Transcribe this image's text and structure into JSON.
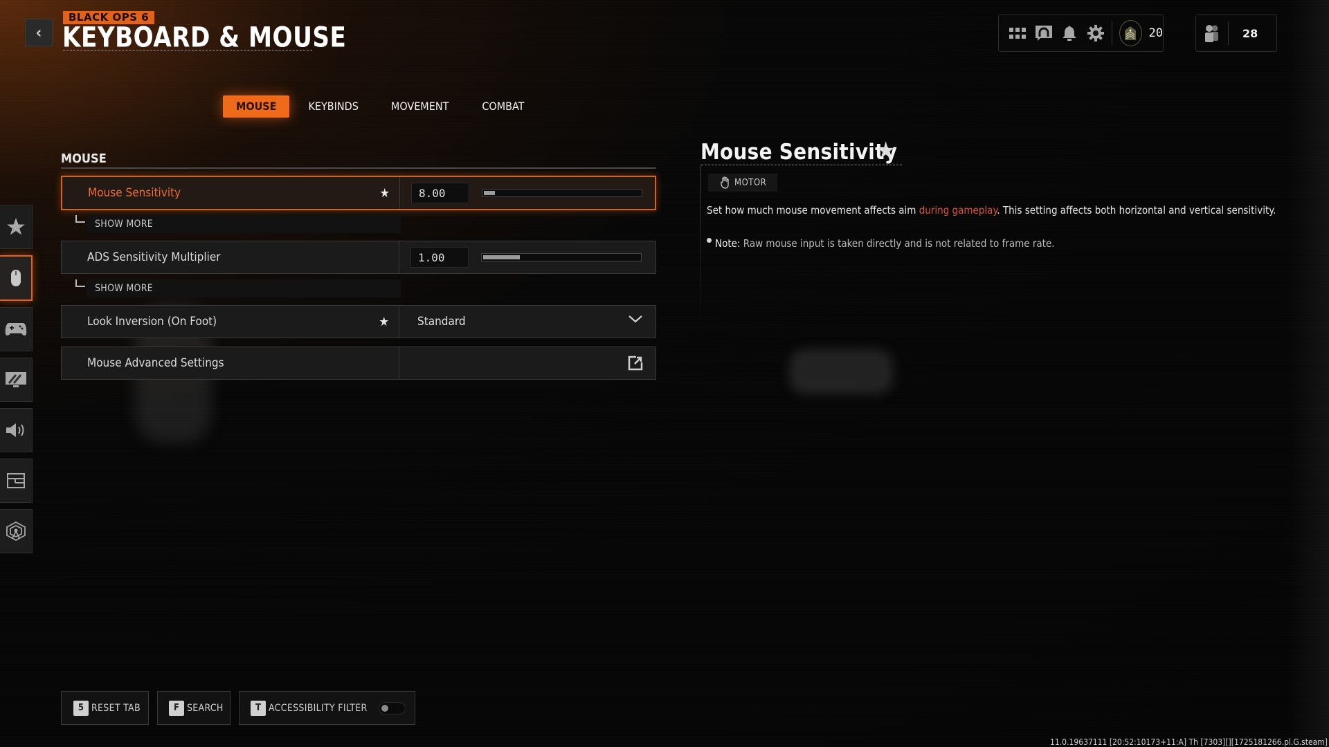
{
  "header": {
    "brand": "BLACK OPS 6",
    "title": "KEYBOARD & MOUSE",
    "back_icon": "chevron-left-icon"
  },
  "topbar": {
    "icons": [
      "grid-menu-icon",
      "headset-support-icon",
      "bell-icon",
      "gear-icon"
    ],
    "rank_icon": "rank-chevron-icon",
    "level": "20",
    "social_icon": "friends-icon",
    "friends_count": "28"
  },
  "tabs": [
    {
      "label": "MOUSE",
      "active": true
    },
    {
      "label": "KEYBINDS",
      "active": false
    },
    {
      "label": "MOVEMENT",
      "active": false
    },
    {
      "label": "COMBAT",
      "active": false
    }
  ],
  "sidebar": {
    "items": [
      {
        "icon": "star-icon",
        "active": false
      },
      {
        "icon": "mouse-icon",
        "active": true
      },
      {
        "icon": "gamepad-icon",
        "active": false
      },
      {
        "icon": "monitor-graphics-icon",
        "active": false
      },
      {
        "icon": "speaker-audio-icon",
        "active": false
      },
      {
        "icon": "interface-layout-icon",
        "active": false
      },
      {
        "icon": "network-icon",
        "active": false
      }
    ]
  },
  "section": {
    "label": "MOUSE",
    "settings": [
      {
        "label": "Mouse Sensitivity",
        "favorite": true,
        "type": "slider",
        "value": "8.00",
        "fill_fraction": 0.07,
        "show_more": "SHOW MORE",
        "focused": true
      },
      {
        "label": "ADS Sensitivity Multiplier",
        "favorite": false,
        "type": "slider",
        "value": "1.00",
        "fill_fraction": 0.23,
        "show_more": "SHOW MORE",
        "focused": false
      },
      {
        "label": "Look Inversion (On Foot)",
        "favorite": true,
        "type": "dropdown",
        "value": "Standard"
      },
      {
        "label": "Mouse Advanced Settings",
        "favorite": false,
        "type": "link"
      }
    ]
  },
  "detail": {
    "title": "Mouse Sensitivity",
    "tag": "MOTOR",
    "description_pre": "Set how much mouse movement affects aim ",
    "description_highlight": "during gameplay",
    "description_post": ". This setting affects both horizontal and vertical sensitivity.",
    "note_label": "Note:",
    "note_text": " Raw mouse input is taken directly and is not related to frame rate."
  },
  "bottom": {
    "reset": {
      "key": "5",
      "label": "RESET TAB"
    },
    "search": {
      "key": "F",
      "label": "SEARCH"
    },
    "accessibility": {
      "key": "T",
      "label": "ACCESSIBILITY FILTER",
      "enabled": false
    }
  },
  "build_string": "11.0.19637111 [20:52:10173+11:A] Th [7303][][1725181266.pl.G.steam]",
  "colors": {
    "accent": "#f06a1c",
    "highlight_text": "#e0533a"
  }
}
